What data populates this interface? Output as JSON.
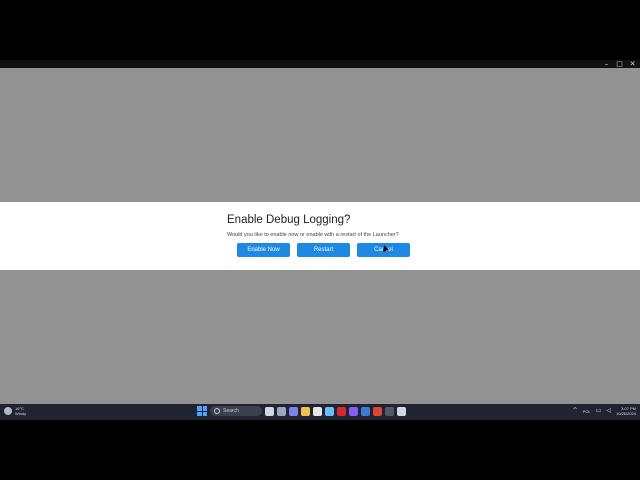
{
  "window": {
    "controls": {
      "minimize": "–",
      "maximize": "□",
      "close": "✕"
    }
  },
  "dialog": {
    "title": "Enable Debug Logging?",
    "message": "Would you like to enable now or enable with a restart of the Launcher?",
    "buttons": {
      "enable_now": "Enable Now",
      "restart": "Restart",
      "cancel": "Cancel"
    },
    "button_color": "#1e88e5"
  },
  "taskbar": {
    "weather": {
      "temp": "16°C",
      "condition": "Windy"
    },
    "search_placeholder": "Search",
    "apps": [
      {
        "icon": "widgets-icon",
        "color": "#cfd6e4"
      },
      {
        "icon": "task-view-icon",
        "color": "#9aa6bd"
      },
      {
        "icon": "chat-icon",
        "color": "#7b83eb"
      },
      {
        "icon": "file-explorer-icon",
        "color": "#f2c14e"
      },
      {
        "icon": "store-icon",
        "color": "#e6e6e6"
      },
      {
        "icon": "steam-icon",
        "color": "#66c0f4"
      },
      {
        "icon": "app-red-icon",
        "color": "#d9272e"
      },
      {
        "icon": "app-purple-icon",
        "color": "#8a5cf6"
      },
      {
        "icon": "app-blue-icon",
        "color": "#3a7bd5"
      },
      {
        "icon": "chrome-icon",
        "color": "#db4437"
      },
      {
        "icon": "app-dark-icon",
        "color": "#555b66"
      },
      {
        "icon": "settings-icon",
        "color": "#cfd6e4"
      }
    ],
    "tray": {
      "chevron": "^",
      "language": "POL",
      "time": "3:07 PM",
      "date": "10/26/2024"
    }
  }
}
